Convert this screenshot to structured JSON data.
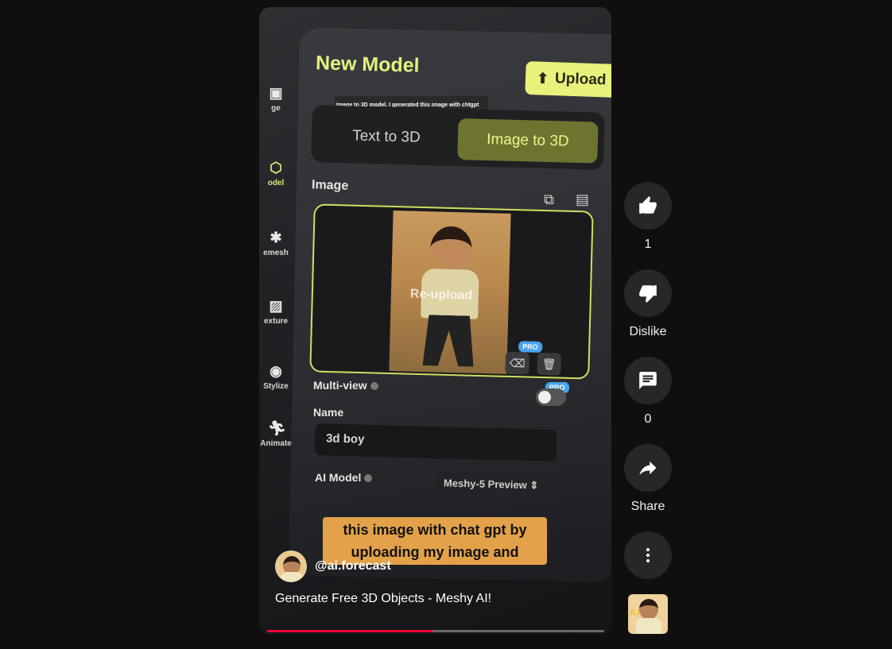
{
  "app": {
    "overlay_caption": "Image to 3D model. I generated this image with chtgpt",
    "subtitle": "this image with chat gpt by uploading my image and",
    "channel": "@ai.forecast",
    "video_title": "Generate Free 3D Objects - Meshy AI!",
    "progress_fraction": 0.49
  },
  "in_video": {
    "title": "New Model",
    "upload_label": "Upload",
    "tabs": [
      "Text to 3D",
      "Image to 3D"
    ],
    "image_label": "Image",
    "reupload": "Re-upload",
    "pro": "PRO",
    "multiview": "Multi-view",
    "name_label": "Name",
    "name_value": "3d boy",
    "ai_model_label": "AI Model",
    "ai_model_value": "Meshy-5 Preview",
    "rail": [
      {
        "label": "ge",
        "icon": "image-icon"
      },
      {
        "label": "odel",
        "icon": "cube-icon"
      },
      {
        "label": "emesh",
        "icon": "remesh-icon"
      },
      {
        "label": "exture",
        "icon": "texture-icon"
      },
      {
        "label": "Stylize",
        "icon": "stylize-icon"
      },
      {
        "label": "Animate",
        "icon": "animate-icon"
      }
    ]
  },
  "actions": {
    "like_count": "1",
    "dislike_label": "Dislike",
    "comment_count": "0",
    "share_label": "Share"
  },
  "colors": {
    "accent": "#e4f07d",
    "progress": "#ff0033",
    "button_bg": "#272727"
  }
}
